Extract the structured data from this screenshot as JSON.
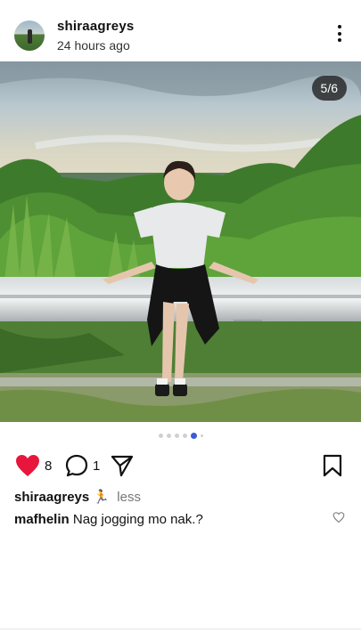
{
  "post": {
    "username": "shiraagreys",
    "time_ago": "24 hours ago",
    "image_counter": "5/6",
    "carousel": {
      "total": 6,
      "current": 5
    },
    "likes": "8",
    "comments": "1",
    "caption_username": "shiraagreys",
    "caption_emoji": "🏃",
    "caption_less": "less",
    "top_comment": {
      "username": "mafhelin",
      "text": "Nag jogging mo nak.?"
    }
  },
  "icons": {
    "avatar": "profile-photo",
    "more": "vertical-ellipsis-icon",
    "like": "heart-filled-icon",
    "comment": "speech-bubble-icon",
    "share": "paper-plane-icon",
    "save": "bookmark-icon",
    "comment_like": "heart-outline-icon"
  },
  "colors": {
    "like": "#e8163c",
    "carousel_active": "#3b5bdb",
    "counter_bg": "#1e1e1e"
  }
}
